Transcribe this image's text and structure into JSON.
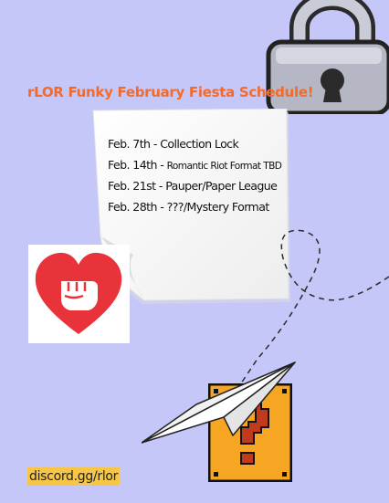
{
  "title": "rLOR Funky February Fiesta Schedule!",
  "schedule": [
    {
      "date": "Feb. 7th - ",
      "event": "Collection Lock",
      "small": false
    },
    {
      "date": "Feb. 14th - ",
      "event": "Romantic Riot Format TBD",
      "small": true
    },
    {
      "date": "Feb. 21st - ",
      "event": "Pauper/Paper League",
      "small": false
    },
    {
      "date": "Feb. 28th - ",
      "event": "???/Mystery Format",
      "small": false
    }
  ],
  "footer_link": "discord.gg/rlor",
  "colors": {
    "background": "#c4c7f8",
    "title": "#f46a2a",
    "footer_highlight": "#f7c646",
    "heart": "#e8333a",
    "question_block": "#f6a623"
  },
  "icons": [
    "padlock-icon",
    "heart-fist-icon",
    "paper-plane-icon",
    "question-block-icon"
  ]
}
